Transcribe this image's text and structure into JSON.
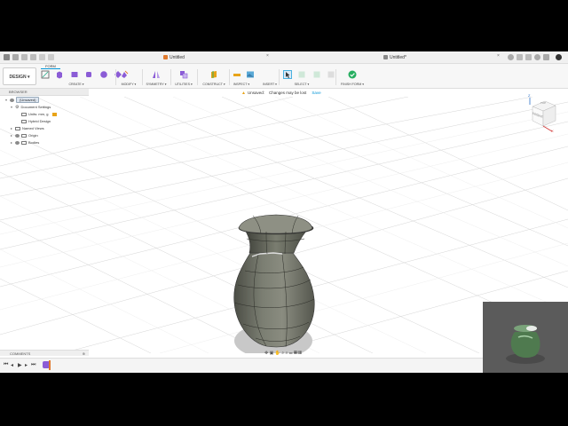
{
  "titlebar": {
    "tab_left": "Untitled",
    "tab_right": "Untitled*"
  },
  "ribbon": {
    "design_label": "DESIGN ▾",
    "active_tab": "FORM",
    "groups": {
      "create": "CREATE ▾",
      "modify": "MODIFY ▾",
      "symmetry": "SYMMETRY ▾",
      "utilities": "UTILITIES ▾",
      "construct": "CONSTRUCT ▾",
      "inspect": "INSPECT ▾",
      "insert": "INSERT ▾",
      "select": "SELECT ▾",
      "finish_form": "FINISH FORM ▾"
    }
  },
  "warning": {
    "label": "Unsaved:",
    "message": "Changes may be lost",
    "save": "Save"
  },
  "browser": {
    "header": "BROWSER",
    "root": "(Unsaved)",
    "items": {
      "document_settings": "Document Settings",
      "units": "Units: mm, g",
      "hybrid_design": "Hybrid Design",
      "named_views": "Named Views",
      "origin": "Origin",
      "bodies": "Bodies"
    }
  },
  "viewcube": {
    "front": "FRONT",
    "top": "TOP",
    "axis_x": "X",
    "axis_z": "Z"
  },
  "comments": {
    "label": "COMMENTS"
  },
  "colors": {
    "accent": "#0696d7",
    "form_purple": "#8b5cd6",
    "finish_green": "#27ae60",
    "vase_body": "#6f7266"
  },
  "icons": {
    "warning": "warning-icon",
    "eye": "eye-icon",
    "folder": "folder-icon",
    "gear": "gear-icon"
  }
}
